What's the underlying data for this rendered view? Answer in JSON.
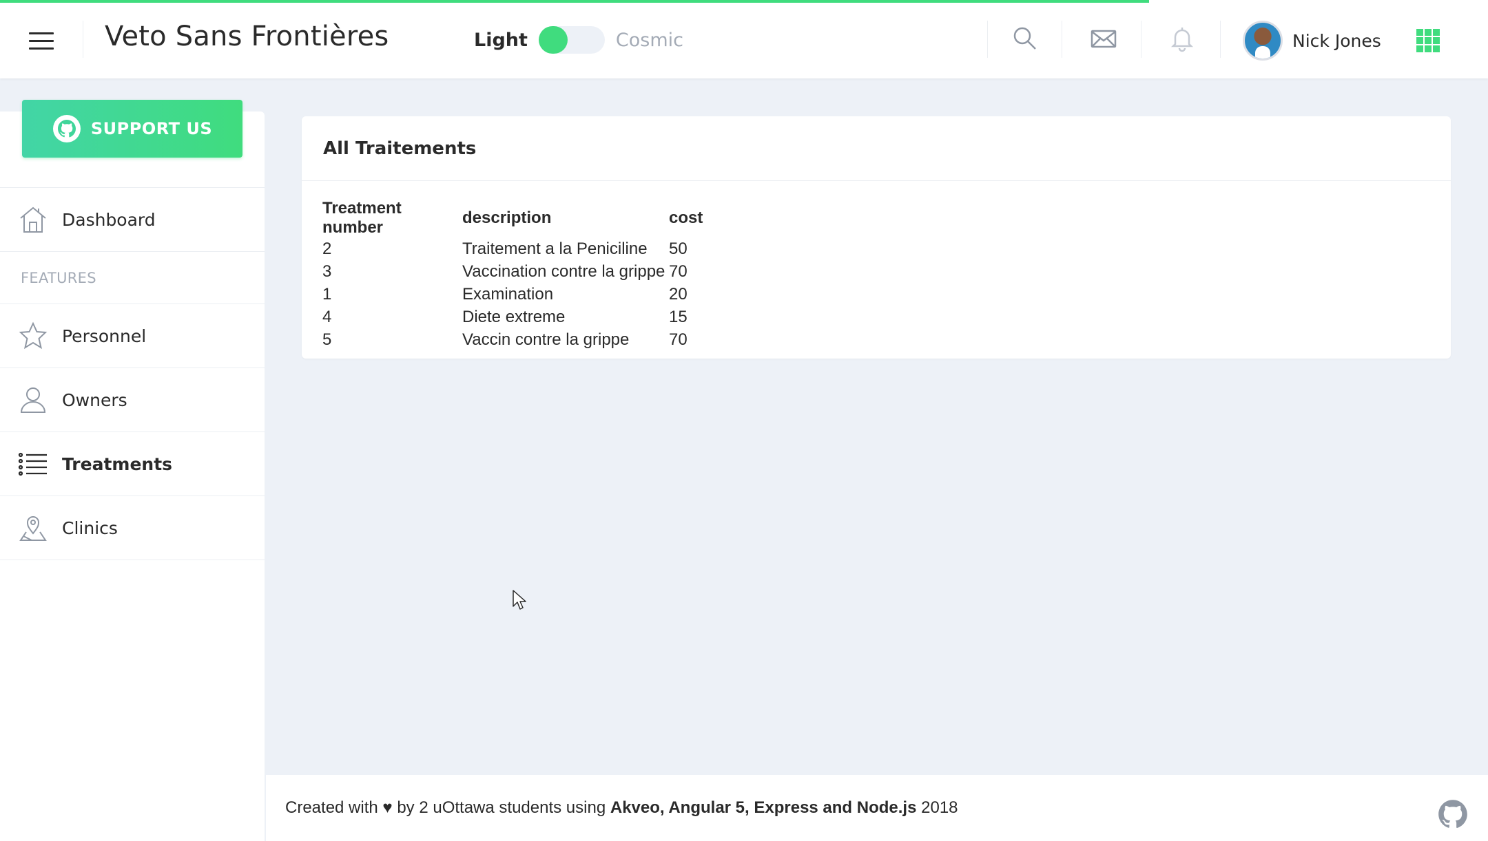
{
  "header": {
    "brand": "Veto Sans Frontières",
    "theme_light_label": "Light",
    "theme_cosmic_label": "Cosmic",
    "user_name": "Nick Jones",
    "accent_color": "#40dc7e"
  },
  "sidebar": {
    "support_label": "SUPPORT US",
    "dashboard_label": "Dashboard",
    "features_label": "FEATURES",
    "items": [
      {
        "label": "Personnel",
        "icon": "star-icon"
      },
      {
        "label": "Owners",
        "icon": "person-icon"
      },
      {
        "label": "Treatments",
        "icon": "list-icon",
        "active": true
      },
      {
        "label": "Clinics",
        "icon": "map-pin-icon"
      }
    ]
  },
  "card": {
    "title": "All Traitements",
    "columns": [
      "Treatment number",
      "description",
      "cost"
    ],
    "rows": [
      [
        "2",
        "Traitement a la Peniciline",
        "50"
      ],
      [
        "3",
        "Vaccination contre la grippe",
        "70"
      ],
      [
        "1",
        "Examination",
        "20"
      ],
      [
        "4",
        "Diete extreme",
        "15"
      ],
      [
        "5",
        "Vaccin contre la grippe",
        "70"
      ]
    ]
  },
  "footer": {
    "prefix": "Created with",
    "heart": "♥",
    "middle": "by 2 uOttawa students using",
    "bold": "Akveo, Angular 5, Express and Node.js",
    "year": "2018"
  }
}
